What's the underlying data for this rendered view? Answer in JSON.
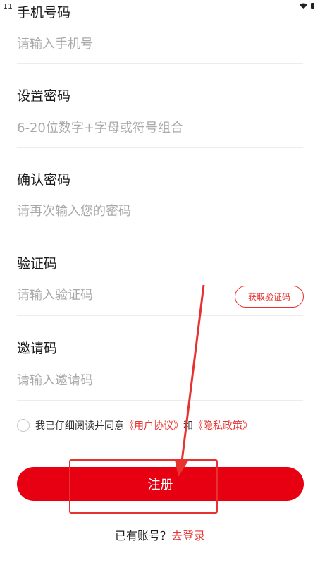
{
  "status_bar": {
    "time": "11"
  },
  "form": {
    "phone": {
      "label": "手机号码",
      "placeholder": "请输入手机号"
    },
    "password": {
      "label": "设置密码",
      "placeholder": "6-20位数字+字母或符号组合"
    },
    "confirm_password": {
      "label": "确认密码",
      "placeholder": "请再次输入您的密码"
    },
    "verify_code": {
      "label": "验证码",
      "placeholder": "请输入验证码",
      "button": "获取验证码"
    },
    "invite_code": {
      "label": "邀请码",
      "placeholder": "请输入邀请码"
    }
  },
  "agreement": {
    "prefix": "我已仔细阅读并同意",
    "user_agreement": "《用户协议》",
    "and": "和",
    "privacy_policy": "《隐私政策》"
  },
  "register_button": "注册",
  "login": {
    "prompt": "已有账号？",
    "link": "去登录"
  },
  "colors": {
    "accent": "#e60012",
    "link": "#e8322f",
    "placeholder": "#a9a9a9"
  },
  "icons": [
    "wifi-icon",
    "battery-icon"
  ]
}
